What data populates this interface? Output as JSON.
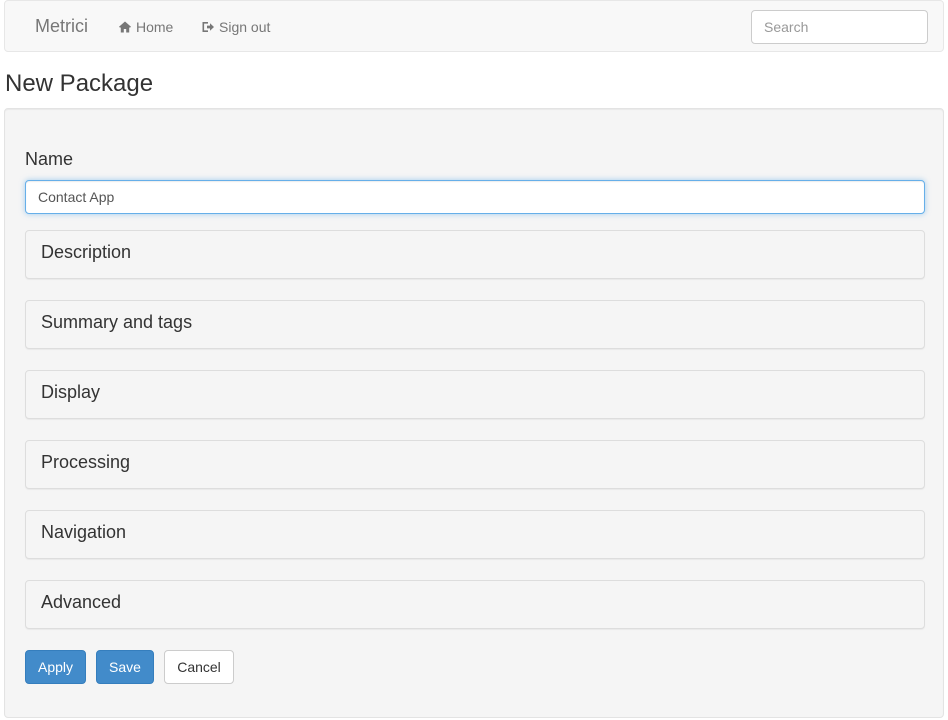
{
  "navbar": {
    "brand": "Metrici",
    "links": [
      {
        "label": "Home",
        "icon": "home-icon"
      },
      {
        "label": "Sign out",
        "icon": "sign-out-icon"
      }
    ],
    "search_placeholder": "Search"
  },
  "page": {
    "title": "New Package"
  },
  "form": {
    "name_label": "Name",
    "name_value": "Contact App",
    "sections": [
      {
        "label": "Description"
      },
      {
        "label": "Summary and tags"
      },
      {
        "label": "Display"
      },
      {
        "label": "Processing"
      },
      {
        "label": "Navigation"
      },
      {
        "label": "Advanced"
      }
    ],
    "buttons": {
      "apply": "Apply",
      "save": "Save",
      "cancel": "Cancel"
    }
  },
  "colors": {
    "primary": "#428bca",
    "navbar_bg": "#f8f8f8",
    "well_bg": "#f5f5f5",
    "focus_border": "#66afe9"
  }
}
